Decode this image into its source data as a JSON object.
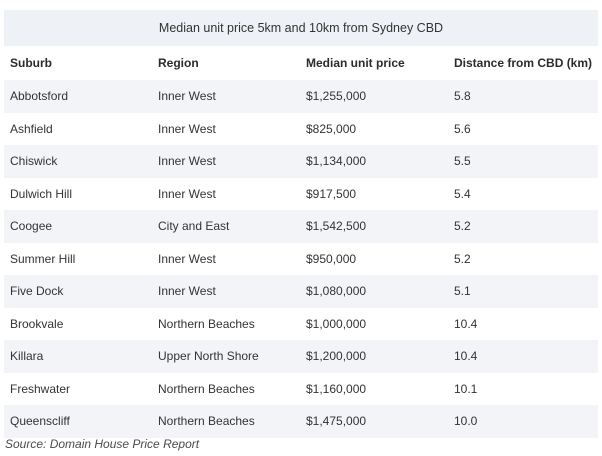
{
  "table": {
    "caption": "Median unit price 5km and 10km from Sydney CBD",
    "headers": [
      "Suburb",
      "Region",
      "Median unit price",
      "Distance from CBD (km)"
    ],
    "rows": [
      [
        "Abbotsford",
        "Inner West",
        "$1,255,000",
        "5.8"
      ],
      [
        "Ashfield",
        "Inner West",
        "$825,000",
        "5.6"
      ],
      [
        "Chiswick",
        "Inner West",
        "$1,134,000",
        "5.5"
      ],
      [
        "Dulwich Hill",
        "Inner West",
        "$917,500",
        "5.4"
      ],
      [
        "Coogee",
        "City and East",
        "$1,542,500",
        "5.2"
      ],
      [
        "Summer Hill",
        "Inner West",
        "$950,000",
        "5.2"
      ],
      [
        "Five Dock",
        "Inner West",
        "$1,080,000",
        "5.1"
      ],
      [
        "Brookvale",
        "Northern Beaches",
        "$1,000,000",
        "10.4"
      ],
      [
        "Killara",
        "Upper North Shore",
        "$1,200,000",
        "10.4"
      ],
      [
        "Freshwater",
        "Northern Beaches",
        "$1,160,000",
        "10.1"
      ],
      [
        "Queenscliff",
        "Northern Beaches",
        "$1,475,000",
        "10.0"
      ]
    ]
  },
  "source": "Source: Domain House Price Report"
}
